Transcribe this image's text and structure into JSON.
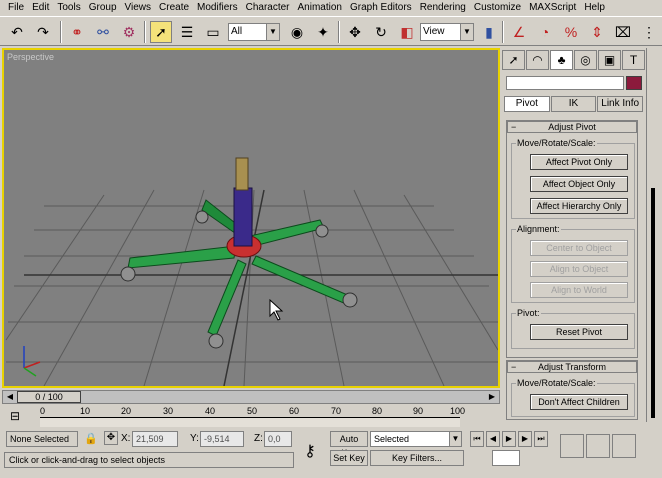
{
  "menu": [
    "File",
    "Edit",
    "Tools",
    "Group",
    "Views",
    "Create",
    "Modifiers",
    "Character",
    "Animation",
    "Graph Editors",
    "Rendering",
    "Customize",
    "MAXScript",
    "Help"
  ],
  "toolbar": {
    "filter_value": "All",
    "refcoord_value": "View"
  },
  "viewport": {
    "label": "Perspective"
  },
  "command_panel": {
    "subtabs": [
      "Pivot",
      "IK",
      "Link Info"
    ],
    "adjust_pivot": {
      "title": "Adjust Pivot",
      "move_group": "Move/Rotate/Scale:",
      "buttons": [
        "Affect Pivot Only",
        "Affect Object Only",
        "Affect Hierarchy Only"
      ],
      "alignment_group": "Alignment:",
      "align_buttons": [
        "Center to Object",
        "Align to Object",
        "Align to World"
      ],
      "pivot_group": "Pivot:",
      "reset_button": "Reset Pivot"
    },
    "adjust_transform": {
      "title": "Adjust Transform",
      "move_group": "Move/Rotate/Scale:",
      "button": "Don't Affect Children"
    }
  },
  "timeline": {
    "frame": "0 / 100",
    "ticks": [
      "0",
      "10",
      "20",
      "30",
      "40",
      "50",
      "60",
      "70",
      "80",
      "90",
      "100"
    ]
  },
  "status": {
    "selection": "None Selected",
    "x_label": "X:",
    "x_value": "21,509",
    "y_label": "Y:",
    "y_value": "-9,514",
    "z_label": "Z:",
    "z_value": "0,0",
    "autokey": "Auto Key",
    "setkey": "Set Key",
    "selected_value": "Selected",
    "keyfilters": "Key Filters...",
    "prompt": "Click or click-and-drag to select objects"
  }
}
